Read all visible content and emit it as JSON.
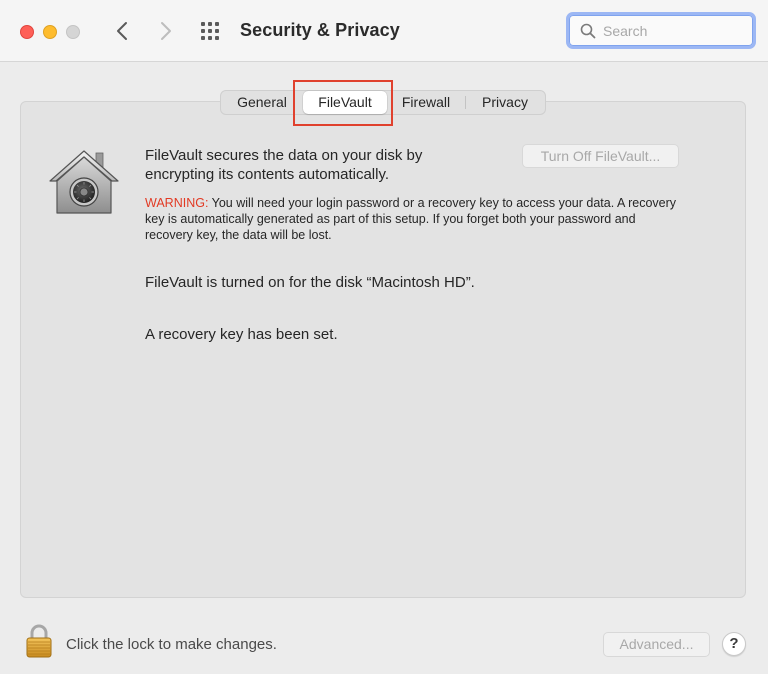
{
  "window": {
    "title": "Security & Privacy"
  },
  "search": {
    "placeholder": "Search",
    "value": ""
  },
  "tabs": [
    {
      "label": "General",
      "selected": false
    },
    {
      "label": "FileVault",
      "selected": true
    },
    {
      "label": "Firewall",
      "selected": false
    },
    {
      "label": "Privacy",
      "selected": false
    }
  ],
  "filevault": {
    "description": "FileVault secures the data on your disk by encrypting its contents automatically.",
    "turn_off_label": "Turn Off FileVault...",
    "warning_label": "WARNING:",
    "warning_text": " You will need your login password or a recovery key to access your data. A recovery key is automatically generated as part of this setup. If you forget both your password and recovery key, the data will be lost.",
    "status": "FileVault is turned on for the disk “Macintosh HD”.",
    "recovery": "A recovery key has been set."
  },
  "footer": {
    "lock_text": "Click the lock to make changes.",
    "advanced_label": "Advanced...",
    "help_label": "?"
  },
  "icons": {
    "close": "close-button",
    "minimize": "minimize-button",
    "zoom": "zoom-button",
    "back": "chevron-left-icon",
    "forward": "chevron-right-icon",
    "grid": "grid-icon",
    "search": "search-icon",
    "filevault": "house-safe-icon",
    "lock": "padlock-icon"
  },
  "colors": {
    "accent_focus": "#9cb7f4",
    "warning": "#e23a24",
    "highlight": "#e0412e",
    "close": "#fe5f57",
    "minimize": "#febc2e"
  }
}
